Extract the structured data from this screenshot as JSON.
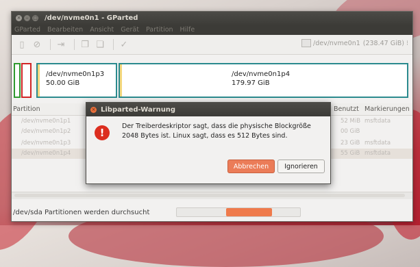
{
  "window": {
    "title": "/dev/nvme0n1 - GParted",
    "menus": [
      "GParted",
      "Bearbeiten",
      "Ansicht",
      "Gerät",
      "Partition",
      "Hilfe"
    ],
    "device_selector": "/dev/nvme0n1",
    "device_size": "(238.47 GiB)"
  },
  "graph": {
    "p3": {
      "name": "/dev/nvme0n1p3",
      "size": "50.00 GiB"
    },
    "p4": {
      "name": "/dev/nvme0n1p4",
      "size": "179.97 GiB"
    }
  },
  "table": {
    "headers": [
      "Partition",
      "Benutzt",
      "Markierungen"
    ],
    "rows": [
      {
        "partition": "/dev/nvme0n1p1",
        "used": "52 MiB",
        "flags": "msftdata"
      },
      {
        "partition": "/dev/nvme0n1p2",
        "used": "00 GiB",
        "flags": ""
      },
      {
        "partition": "/dev/nvme0n1p3",
        "used": "23 GiB",
        "flags": "msftdata"
      },
      {
        "partition": "/dev/nvme0n1p4",
        "used": "55 GiB",
        "flags": "msftdata"
      }
    ]
  },
  "status": {
    "text": "/dev/sda Partitionen werden durchsucht",
    "progress": 0.37
  },
  "dialog": {
    "title": "Libparted-Warnung",
    "message": "Der Treiberdeskriptor sagt, dass die physische Blockgröße 2048 Bytes ist. Linux sagt, dass es 512 Bytes sind.",
    "cancel_label": "Abbrechen",
    "ignore_label": "Ignorieren"
  },
  "colors": {
    "accent": "#eb7c58",
    "partition_border": "#2a8a8e",
    "error": "#dc2e1f"
  },
  "icons": [
    "new-icon",
    "delete-icon",
    "resize-icon",
    "copy-icon",
    "paste-icon",
    "apply-icon",
    "disk-icon",
    "error-icon"
  ]
}
